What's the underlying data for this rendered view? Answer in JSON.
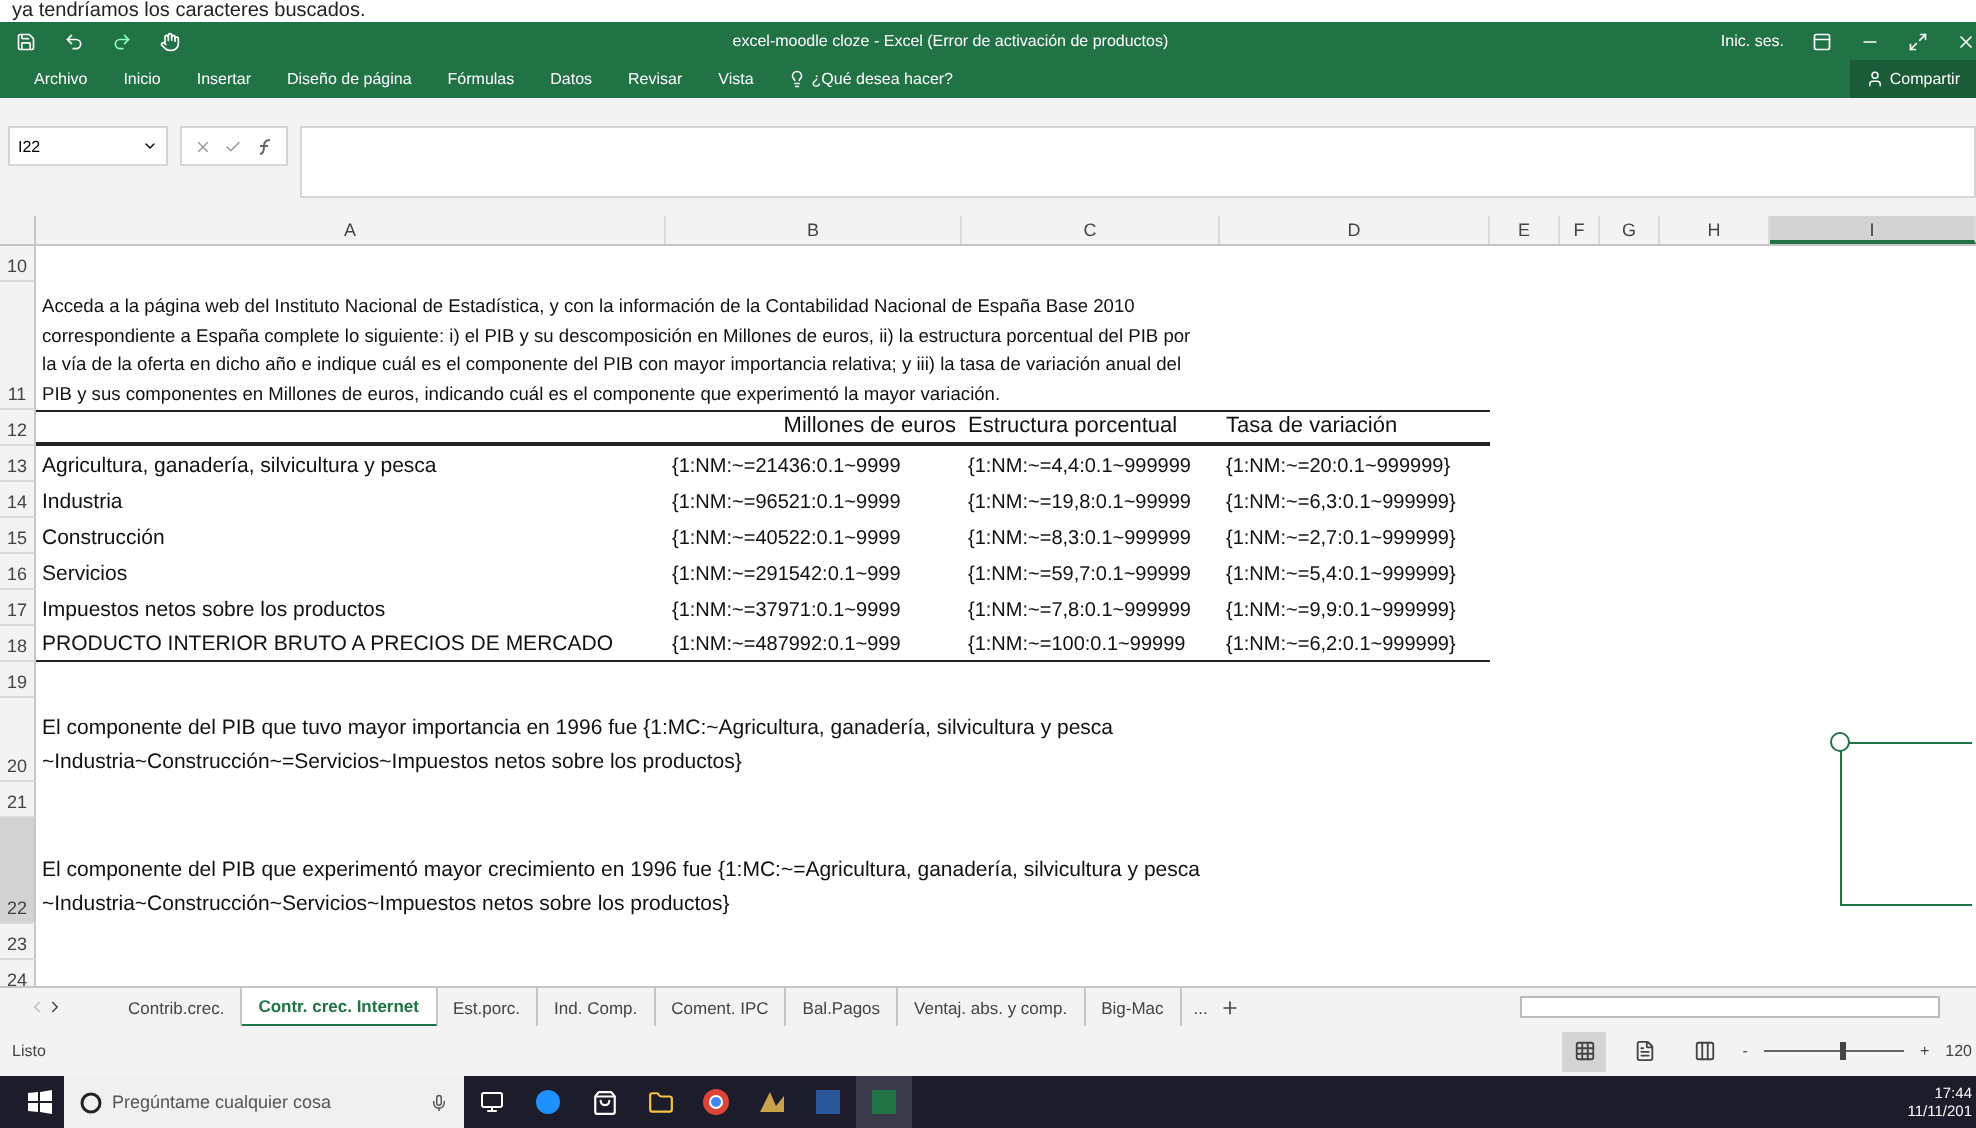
{
  "caption": "ya tendríamos los caracteres buscados.",
  "title_bar": {
    "title": "excel-moodle cloze  -  Excel (Error de activación de productos)",
    "account": "Inic. ses."
  },
  "ribbon": {
    "tabs": [
      {
        "label": "Archivo"
      },
      {
        "label": "Inicio"
      },
      {
        "label": "Insertar"
      },
      {
        "label": "Diseño de página"
      },
      {
        "label": "Fórmulas"
      },
      {
        "label": "Datos"
      },
      {
        "label": "Revisar"
      },
      {
        "label": "Vista"
      }
    ],
    "tell_me": "¿Qué desea hacer?",
    "share": "Compartir"
  },
  "formula_bar": {
    "name_box": "I22"
  },
  "columns": [
    {
      "label": "A",
      "selected": false
    },
    {
      "label": "B",
      "selected": false
    },
    {
      "label": "C",
      "selected": false
    },
    {
      "label": "D",
      "selected": false
    },
    {
      "label": "E",
      "selected": false
    },
    {
      "label": "F",
      "selected": false
    },
    {
      "label": "G",
      "selected": false
    },
    {
      "label": "H",
      "selected": false
    },
    {
      "label": "I",
      "selected": true
    }
  ],
  "rows": [
    {
      "number": "10",
      "kind": "blank",
      "selected": false
    },
    {
      "number": "11",
      "kind": "note",
      "selected": false,
      "lines": [
        "Acceda a la página web del Instituto Nacional de Estadística, y con la información de la Contabilidad Nacional de España Base 2010",
        "correspondiente a España complete lo siguiente: i) el PIB y su descomposición en Millones de euros, ii) la estructura porcentual del PIB por",
        "la vía de la oferta en dicho año e indique cuál es el componente del PIB con mayor importancia relativa; y iii) la tasa de variación anual del",
        "PIB y sus componentes en Millones de euros, indicando cuál es el componente que experimentó la mayor variación."
      ]
    },
    {
      "number": "12",
      "kind": "header",
      "selected": false,
      "cells": [
        "Millones de euros",
        "Estructura porcentual",
        "Tasa de variación"
      ]
    },
    {
      "number": "13",
      "kind": "data",
      "selected": false,
      "cells": [
        "Agricultura, ganadería, silvicultura y pesca",
        "{1:NM:~=21436:0.1~9999",
        "{1:NM:~=4,4:0.1~999999",
        "{1:NM:~=20:0.1~999999}"
      ]
    },
    {
      "number": "14",
      "kind": "data",
      "selected": false,
      "cells": [
        "Industria",
        "{1:NM:~=96521:0.1~9999",
        "{1:NM:~=19,8:0.1~99999",
        "{1:NM:~=6,3:0.1~999999}"
      ]
    },
    {
      "number": "15",
      "kind": "data",
      "selected": false,
      "cells": [
        "Construcción",
        "{1:NM:~=40522:0.1~9999",
        "{1:NM:~=8,3:0.1~999999",
        "{1:NM:~=2,7:0.1~999999}"
      ]
    },
    {
      "number": "16",
      "kind": "data",
      "selected": false,
      "cells": [
        "Servicios",
        "{1:NM:~=291542:0.1~999",
        "{1:NM:~=59,7:0.1~99999",
        "{1:NM:~=5,4:0.1~999999}"
      ]
    },
    {
      "number": "17",
      "kind": "data",
      "selected": false,
      "cells": [
        "Impuestos netos sobre los productos",
        "{1:NM:~=37971:0.1~9999",
        "{1:NM:~=7,8:0.1~999999",
        "{1:NM:~=9,9:0.1~999999}"
      ]
    },
    {
      "number": "18",
      "kind": "total",
      "selected": false,
      "cells": [
        "PRODUCTO INTERIOR BRUTO A PRECIOS DE MERCADO",
        "{1:NM:~=487992:0.1~999",
        "{1:NM:~=100:0.1~99999",
        "{1:NM:~=6,2:0.1~999999}"
      ]
    },
    {
      "number": "19",
      "kind": "blank",
      "selected": false
    },
    {
      "number": "20",
      "kind": "text",
      "selected": false,
      "lines": [
        "El componente del PIB que tuvo mayor importancia en 1996 fue {1:MC:~Agricultura, ganadería, silvicultura y pesca",
        "~Industria~Construcción~=Servicios~Impuestos netos sobre los productos}"
      ]
    },
    {
      "number": "21",
      "kind": "blank",
      "selected": false
    },
    {
      "number": "22",
      "kind": "text",
      "selected": true,
      "lines": [
        "El componente del PIB que experimentó mayor crecimiento en 1996 fue {1:MC:~=Agricultura, ganadería, silvicultura y pesca",
        "~Industria~Construcción~Servicios~Impuestos netos sobre los productos}"
      ]
    },
    {
      "number": "23",
      "kind": "blank",
      "selected": false
    },
    {
      "number": "24",
      "kind": "blank",
      "selected": false
    }
  ],
  "sheet_tabs": [
    {
      "label": "Contrib.crec.",
      "selected": false
    },
    {
      "label": "Contr. crec. Internet",
      "selected": true
    },
    {
      "label": "Est.porc.",
      "selected": false
    },
    {
      "label": "Ind. Comp.",
      "selected": false
    },
    {
      "label": "Coment. IPC",
      "selected": false
    },
    {
      "label": "Bal.Pagos",
      "selected": false
    },
    {
      "label": "Ventaj. abs. y comp.",
      "selected": false
    },
    {
      "label": "Big-Mac",
      "selected": false
    }
  ],
  "more_tabs": "...",
  "status_bar": {
    "status": "Listo",
    "zoom": {
      "level": 0.55,
      "minus": "-",
      "plus": "+",
      "reading": "120"
    }
  },
  "taskbar": {
    "search": "Pregúntame cualquier cosa",
    "time": "17:44",
    "date": "11/11/201"
  }
}
